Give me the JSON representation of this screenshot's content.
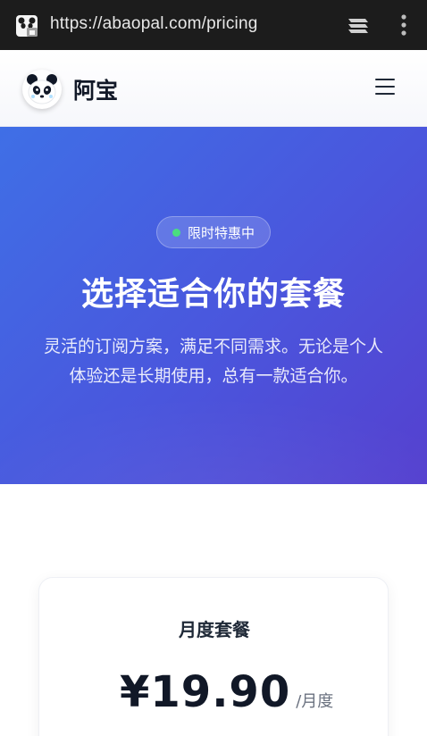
{
  "browser": {
    "url": "https://abaopal.com/pricing",
    "site_icon": "panda-favicon-icon",
    "tabs_icon": "tabs-icon",
    "menu_icon": "more-vertical-icon"
  },
  "header": {
    "brand": "阿宝",
    "logo_icon": "panda-logo-icon",
    "menu_icon": "hamburger-menu-icon"
  },
  "hero": {
    "badge": "限时特惠中",
    "badge_dot_color": "#4ade80",
    "title": "选择适合你的套餐",
    "subtitle_line1": "灵活的订阅方案，满足不同需求。无论是个人",
    "subtitle_line2": "体验还是长期使用，总有一款适合你。",
    "gradient_colors": [
      "#3f6fe6",
      "#5540cf"
    ]
  },
  "plans": [
    {
      "name": "月度套餐",
      "price": "¥19.90",
      "period": "/月度"
    }
  ]
}
